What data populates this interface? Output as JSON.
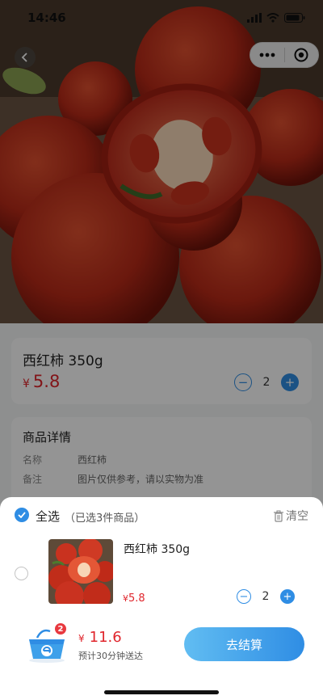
{
  "status_bar": {
    "time": "14:46"
  },
  "capsule": {
    "more_icon": "more-dots-icon",
    "close_icon": "target-circle-icon"
  },
  "product": {
    "title": "西红柿 350g",
    "currency": "¥",
    "price": "5.8",
    "quantity": "2"
  },
  "details": {
    "title": "商品详情",
    "rows": [
      {
        "key": "名称",
        "value": "西红柿"
      },
      {
        "key": "备注",
        "value": "图片仅供参考，请以实物为准"
      }
    ]
  },
  "cart": {
    "select_all_label": "全选",
    "selected_count_text": "（已选3件商品）",
    "clear_label": "清空",
    "items": [
      {
        "name": "西红柿 350g",
        "currency": "¥",
        "price": "5.8",
        "quantity": "2"
      }
    ],
    "badge_count": "2",
    "total_currency": "¥",
    "total": "11.6",
    "eta_text": "预计30分钟送达",
    "checkout_label": "去结算"
  },
  "colors": {
    "accent": "#2f8de4",
    "price": "#e0252c",
    "badge": "#e8393f"
  }
}
